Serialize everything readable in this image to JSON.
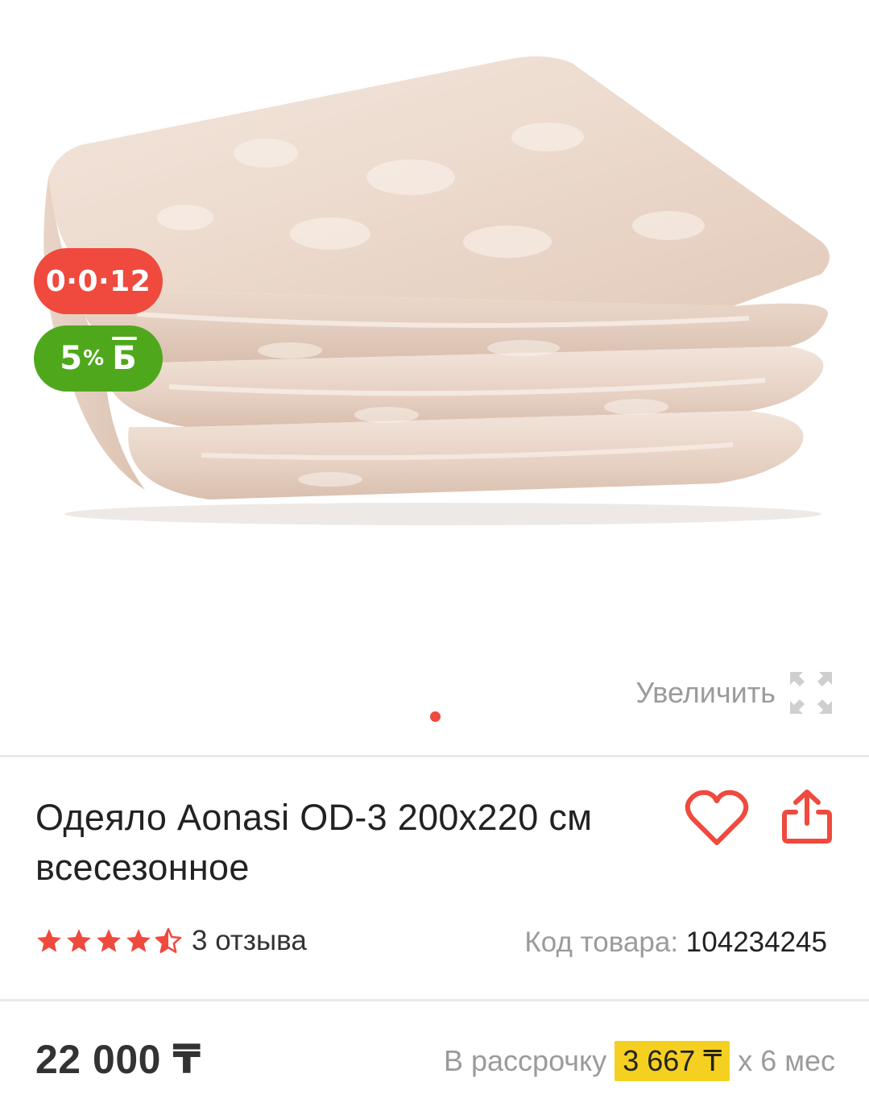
{
  "gallery": {
    "badge_installment": "0·0·12",
    "badge_bonus_value": "5",
    "badge_bonus_percent": "%",
    "badge_bonus_symbol": "Б",
    "zoom_label": "Увеличить",
    "zoom_icon": "expand-icon",
    "slide_count_dots": 1
  },
  "product": {
    "title": "Одеяло Aonasi OD-3 200x220 см всесезонное",
    "favorite_icon": "heart-icon",
    "share_icon": "share-icon",
    "rating": 4.5,
    "reviews_label": "3 отзыва",
    "code_label": "Код товара:",
    "code_value": "104234245"
  },
  "pricing": {
    "price": "22 000 ₸",
    "installment_label": "В рассрочку",
    "installment_amount": "3 667 ₸",
    "installment_term": "x 6 мес"
  },
  "colors": {
    "accent_red": "#f0493e",
    "bonus_green": "#4fa81c",
    "installment_highlight": "#f5d020"
  }
}
